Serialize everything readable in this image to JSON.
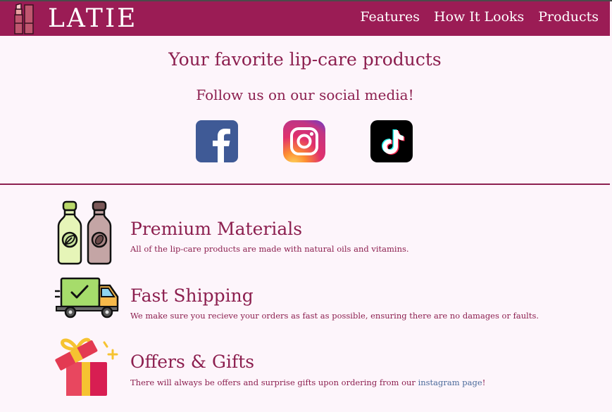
{
  "header": {
    "brand": "LATIE",
    "nav": [
      "Features",
      "How It Looks",
      "Products"
    ],
    "background": "#9b1c55"
  },
  "hero": {
    "title": "Your favorite lip-care products",
    "subtitle": "Follow us on our social media!",
    "social": [
      {
        "icon": "facebook-icon",
        "color": "#3b5998"
      },
      {
        "icon": "instagram-icon",
        "color": "#e1306c"
      },
      {
        "icon": "tiktok-icon",
        "color": "#000000"
      }
    ]
  },
  "features": [
    {
      "icon": "bottles-icon",
      "title": "Premium Materials",
      "description": "All of the lip-care products are made with natural oils and vitamins."
    },
    {
      "icon": "delivery-truck-icon",
      "title": "Fast Shipping",
      "description": "We make sure you recieve your orders as fast as possible, ensuring there are no damages or faults."
    },
    {
      "icon": "gift-box-icon",
      "title": "Offers & Gifts",
      "description_before": "There will always be offers and surprise gifts upon ordering from our ",
      "link_text": "instagram page",
      "description_after": "!"
    }
  ],
  "colors": {
    "accent": "#8c1f4f",
    "page_background": "#fdf5fb",
    "link": "#4b6a9b"
  }
}
